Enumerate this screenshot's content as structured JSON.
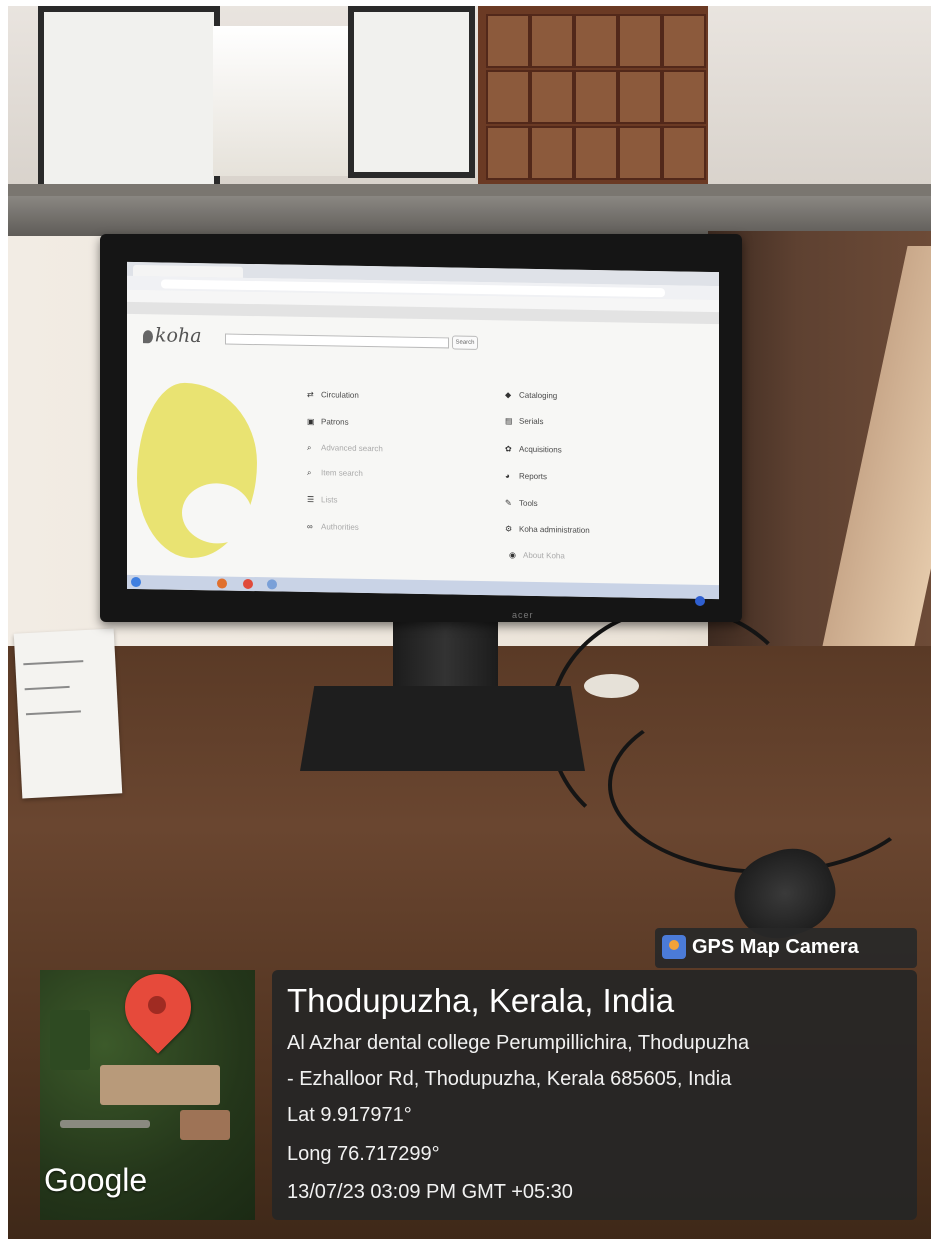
{
  "koha_screen": {
    "logo": "koha",
    "search_button": "Search",
    "menu_left": [
      "Circulation",
      "Patrons",
      "Advanced search",
      "Item search",
      "Lists",
      "Authorities"
    ],
    "menu_right": [
      "Cataloging",
      "Serials",
      "Acquisitions",
      "Reports",
      "Tools",
      "Koha administration",
      "About Koha"
    ]
  },
  "monitor": {
    "brand": "acer"
  },
  "gps": {
    "app_label": "GPS Map Camera",
    "map_attribution": "Google",
    "place": "Thodupuzha, Kerala, India",
    "address_line1": "Al Azhar dental college Perumpillichira, Thodupuzha",
    "address_line2": "- Ezhalloor Rd, Thodupuzha, Kerala 685605, India",
    "lat": "Lat 9.917971°",
    "long": "Long 76.717299°",
    "datetime": "13/07/23 03:09 PM GMT +05:30"
  },
  "colors": {
    "pin": "#e64a3b",
    "overlay": "#262626",
    "koha_elephant": "#e6df5a"
  }
}
